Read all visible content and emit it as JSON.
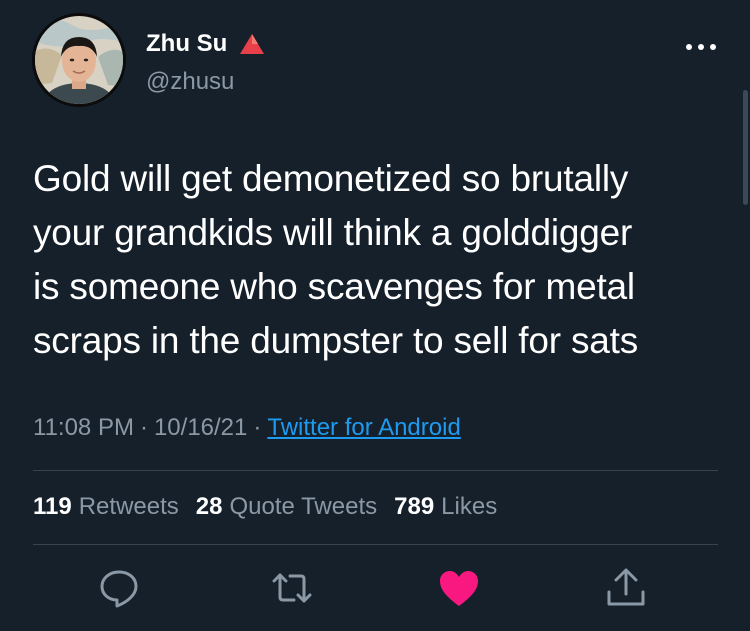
{
  "author": {
    "display_name": "Zhu Su",
    "handle": "@zhusu",
    "badge_icon": "red-triangle-icon",
    "badge_color": "#e8404a"
  },
  "tweet": {
    "lines": [
      "Gold will get demonetized so brutally",
      "your grandkids will think a golddigger",
      "is someone who scavenges for metal",
      "scraps in the dumpster to sell for sats"
    ],
    "time": "11:08 PM",
    "date": "10/16/21",
    "separator": "·",
    "source": "Twitter for Android"
  },
  "stats": {
    "retweets": {
      "count": "119",
      "label": "Retweets"
    },
    "quote_tweets": {
      "count": "28",
      "label": "Quote Tweets"
    },
    "likes": {
      "count": "789",
      "label": "Likes"
    }
  },
  "actions": {
    "reply": "reply-icon",
    "retweet": "retweet-icon",
    "like": "heart-icon",
    "share": "share-icon"
  },
  "colors": {
    "background": "#15202b",
    "text_primary": "#ffffff",
    "text_secondary": "#8b98a5",
    "link": "#1d9bf0",
    "like_active": "#f91880",
    "divider": "#38444d"
  }
}
